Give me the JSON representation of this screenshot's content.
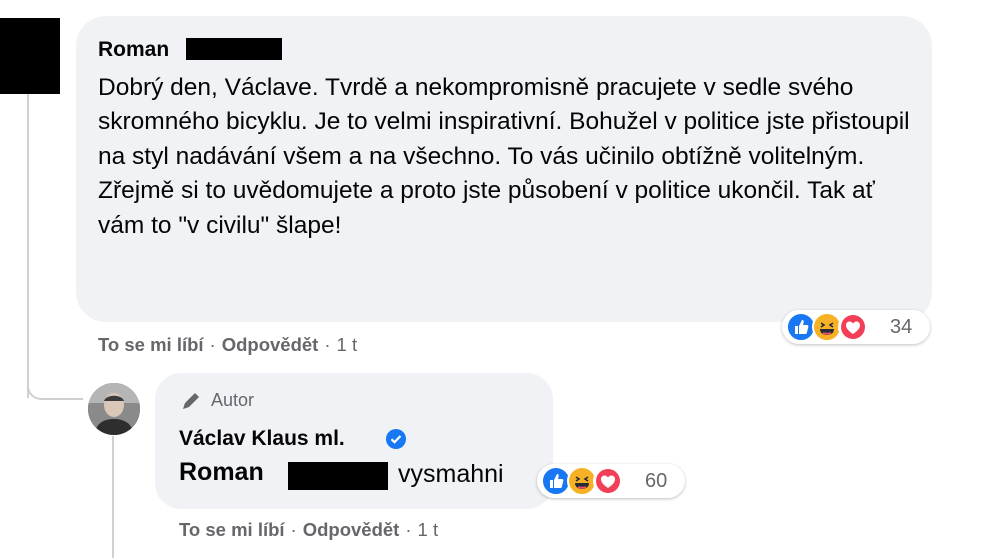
{
  "comment": {
    "author": "Roman",
    "text": "Dobrý den, Václave. Tvrdě a nekompromisně pracujete v sedle svého skromného bicyklu. Je to velmi inspirativní. Bohužel v politice jste přistoupil na styl nadávání všem a na všechno. To vás učinilo obtížně volitelným. Zřejmě si to uvědomujete a proto jste působení v politice ukončil. Tak ať vám to \"v civilu\" šlape!",
    "reaction_count": "34",
    "like_label": "To se mi líbí",
    "reply_label": "Odpovědět",
    "separator": "·",
    "time": "1 t"
  },
  "reply": {
    "badge": "Autor",
    "author": "Václav Klaus ml.",
    "mention": "Roman",
    "text": "vysmahni",
    "reaction_count": "60",
    "like_label": "To se mi líbí",
    "reply_label": "Odpovědět",
    "separator": "·",
    "time": "1 t"
  },
  "colors": {
    "bubble": "#f0f2f5",
    "meta_text": "#65676b",
    "like": "#1877f2",
    "haha": "#f7b125",
    "love": "#f33e58",
    "verified": "#1877f2"
  },
  "icons": [
    "like-reaction-icon",
    "haha-reaction-icon",
    "love-reaction-icon",
    "pen-icon",
    "verified-badge-icon"
  ]
}
